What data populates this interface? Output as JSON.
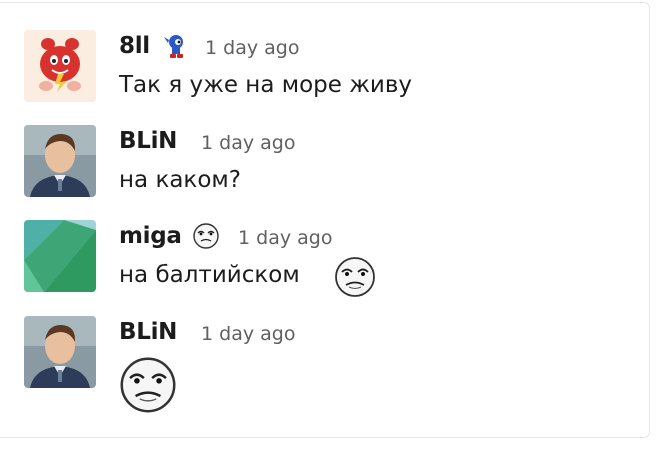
{
  "messages": [
    {
      "author": "8ll",
      "time": "1 day ago",
      "text": "Так я уже на море живу",
      "avatar": "red-pokemon-character-avatar",
      "status_icon": "sonic-emoji"
    },
    {
      "author": "BLiN",
      "time": "1 day ago",
      "text": "на каком?",
      "avatar": "man-portrait-avatar"
    },
    {
      "author": "miga",
      "time": "1 day ago",
      "text": "на балтийском",
      "avatar": "green-blue-geometric-avatar",
      "status_icon": "me-gusta-emoji",
      "inline_emoji": "me-gusta-emoji"
    },
    {
      "author": "BLiN",
      "time": "1 day ago",
      "text": "",
      "avatar": "man-portrait-avatar",
      "emoji_only": "me-gusta-emoji"
    }
  ],
  "colors": {
    "text": "#1d1c1d",
    "muted": "#616061",
    "border": "#e6e6e6"
  }
}
